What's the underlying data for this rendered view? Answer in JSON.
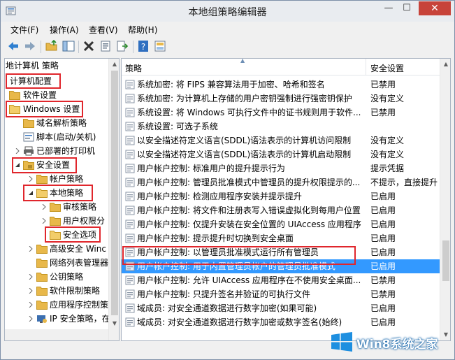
{
  "window": {
    "title": "本地组策略编辑器",
    "minimize": "—",
    "maximize": "☐",
    "close": "✕"
  },
  "menu": {
    "file": "文件(F)",
    "action": "操作(A)",
    "view": "查看(V)",
    "help": "帮助(H)"
  },
  "left": {
    "header": "地计算机 策略",
    "tree": [
      {
        "label": "计算机配置"
      },
      {
        "label": "软件设置"
      },
      {
        "label": "Windows 设置"
      },
      {
        "label": "域名解析策略"
      },
      {
        "label": "脚本(启动/关机)"
      },
      {
        "label": "已部署的打印机"
      },
      {
        "label": "安全设置"
      },
      {
        "label": "帐户策略"
      },
      {
        "label": "本地策略"
      },
      {
        "label": "审核策略"
      },
      {
        "label": "用户权限分"
      },
      {
        "label": "安全选项"
      },
      {
        "label": "高级安全 Winc"
      },
      {
        "label": "网络列表管理器"
      },
      {
        "label": "公钥策略"
      },
      {
        "label": "软件限制策略"
      },
      {
        "label": "应用程序控制策"
      },
      {
        "label": "IP 安全策略，在"
      }
    ]
  },
  "right": {
    "col_policy": "策略",
    "col_setting": "安全设置",
    "rows": [
      {
        "name": "系统加密: 将 FIPS 兼容算法用于加密、哈希和签名",
        "value": "已禁用"
      },
      {
        "name": "系统加密: 为计算机上存储的用户密钥强制进行强密钥保护",
        "value": "没有定义"
      },
      {
        "name": "系统设置: 将 Windows 可执行文件中的证书规则用于软件...",
        "value": "已禁用"
      },
      {
        "name": "系统设置: 可选子系统",
        "value": ""
      },
      {
        "name": "以安全描述符定义语言(SDDL)语法表示的计算机访问限制",
        "value": "没有定义"
      },
      {
        "name": "以安全描述符定义语言(SDDL)语法表示的计算机启动限制",
        "value": "没有定义"
      },
      {
        "name": "用户帐户控制: 标准用户的提升提示行为",
        "value": "提示凭据"
      },
      {
        "name": "用户帐户控制: 管理员批准模式中管理员的提升权限提示的...",
        "value": "不提示，直接提升"
      },
      {
        "name": "用户帐户控制: 检测应用程序安装并提示提升",
        "value": "已启用"
      },
      {
        "name": "用户帐户控制: 将文件和注册表写入错误虚拟化到每用户位置",
        "value": "已启用"
      },
      {
        "name": "用户帐户控制: 仅提升安装在安全位置的 UIAccess 应用程序",
        "value": "已启用"
      },
      {
        "name": "用户帐户控制: 提示提升时切换到安全桌面",
        "value": "已启用"
      },
      {
        "name": "用户帐户控制: 以管理员批准模式运行所有管理员",
        "value": "已启用"
      },
      {
        "name": "用户帐户控制: 用于内置管理员帐户的管理员批准模式",
        "value": "已启用"
      },
      {
        "name": "用户帐户控制: 允许 UIAccess 应用程序在不使用安全桌面...",
        "value": "已禁用"
      },
      {
        "name": "用户帐户控制: 只提升签名并验证的可执行文件",
        "value": "已禁用"
      },
      {
        "name": "域成员: 对安全通道数据进行数字加密(如果可能)",
        "value": "已启用"
      },
      {
        "name": "域成员: 对安全通道数据进行数字加密或数字签名(始终)",
        "value": "已启用"
      }
    ]
  },
  "watermark": {
    "text": "Win8系统之家"
  },
  "colors": {
    "selection": "#3399ff",
    "highlight_box": "#e0262c",
    "close_button": "#c7433a",
    "folder": "#e8b84a"
  }
}
